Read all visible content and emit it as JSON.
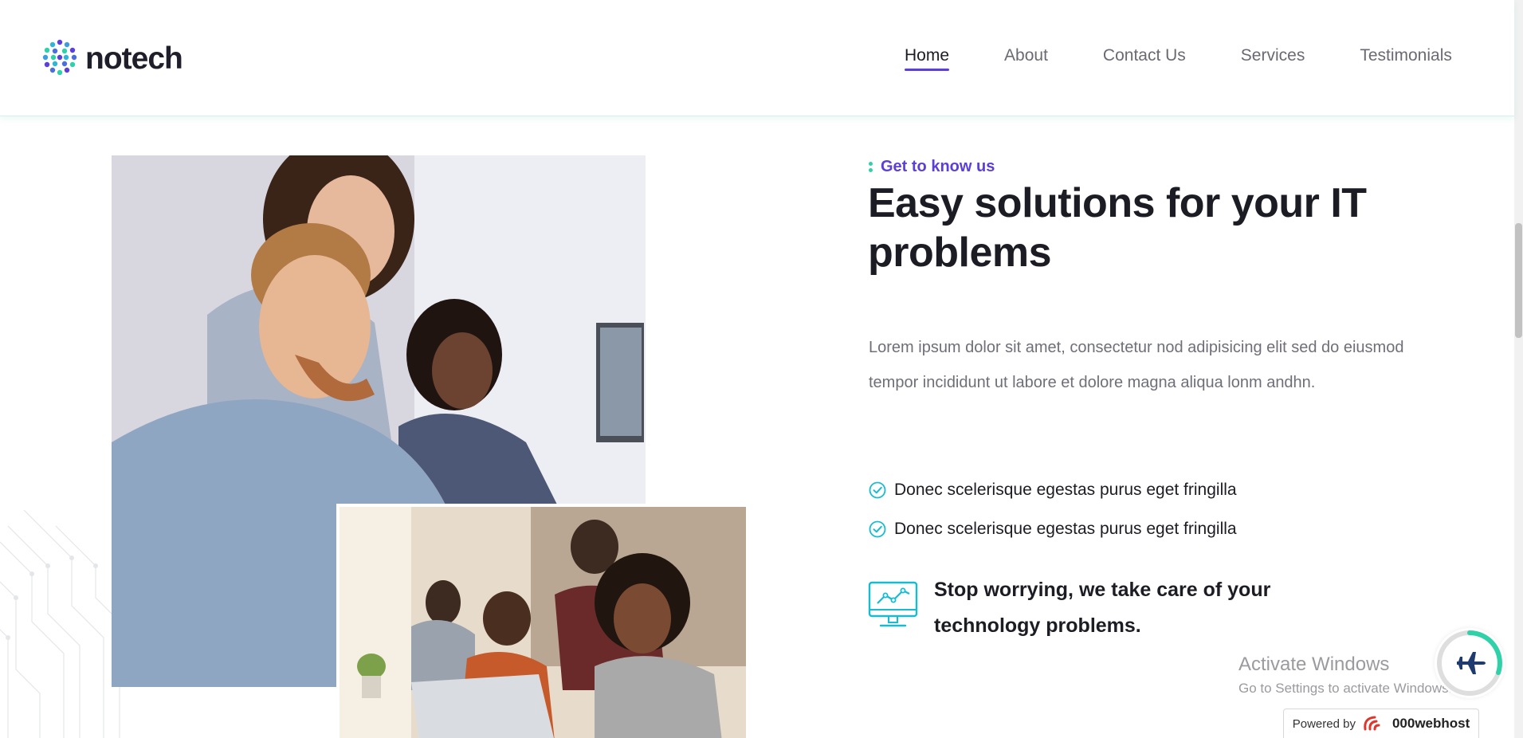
{
  "header": {
    "logo_text": "notech",
    "nav": [
      {
        "label": "Home",
        "active": true
      },
      {
        "label": "About",
        "active": false
      },
      {
        "label": "Contact Us",
        "active": false
      },
      {
        "label": "Services",
        "active": false
      },
      {
        "label": "Testimonials",
        "active": false
      }
    ]
  },
  "about": {
    "eyebrow": "Get to know us",
    "headline": "Easy solutions for your IT problems",
    "body": "Lorem ipsum dolor sit amet, consectetur nod adipisicing elit sed do eiusmod tempor incididunt ut labore et dolore magna aliqua lonm andhn.",
    "checklist": [
      "Donec scelerisque egestas purus eget fringilla",
      "Donec scelerisque egestas purus eget fringilla"
    ],
    "callout": "Stop worrying, we take care of your technology problems."
  },
  "watermark": {
    "title": "Activate Windows",
    "subtitle": "Go to Settings to activate Windows."
  },
  "badge": {
    "label": "Powered by",
    "brand": "000webhost"
  },
  "colors": {
    "accent": "#5b3fd8",
    "teal": "#2fd1a8",
    "icon_cyan": "#17bcd1",
    "heading": "#1c1c24",
    "body_text": "#6f6f7a",
    "nav_text": "#6a6a74"
  },
  "icons": {
    "logo": "globe-dots-icon",
    "check": "check-circle-icon",
    "callout": "monitor-chart-icon",
    "widget": "airplane-icon"
  }
}
